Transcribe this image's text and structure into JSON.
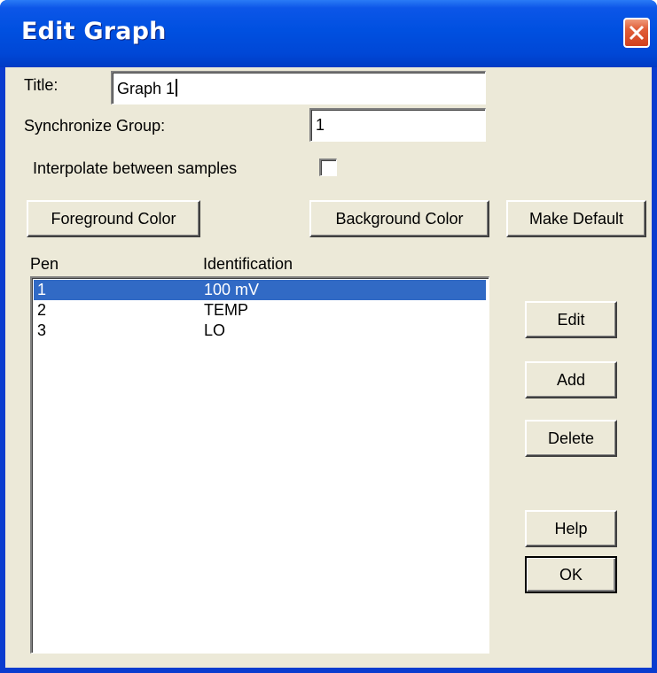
{
  "window": {
    "title": "Edit Graph"
  },
  "form": {
    "title_label": "Title:",
    "title_value": "Graph 1",
    "sync_label": "Synchronize Group:",
    "sync_value": "1",
    "interpolate_label": "Interpolate between samples",
    "interpolate_checked": false
  },
  "buttons": {
    "foreground": "Foreground Color",
    "background": "Background Color",
    "make_default": "Make Default",
    "edit": "Edit",
    "add": "Add",
    "delete": "Delete",
    "help": "Help",
    "ok": "OK"
  },
  "pens": {
    "columns": [
      "Pen",
      "Identification"
    ],
    "rows": [
      {
        "pen": "1",
        "id": "100 mV",
        "selected": true
      },
      {
        "pen": "2",
        "id": "TEMP",
        "selected": false
      },
      {
        "pen": "3",
        "id": "LO",
        "selected": false
      }
    ]
  },
  "colors": {
    "selection": "#316ac5",
    "dialog_bg": "#ece9d8",
    "title_bar": "#0050e0",
    "close_button": "#d1411e"
  }
}
